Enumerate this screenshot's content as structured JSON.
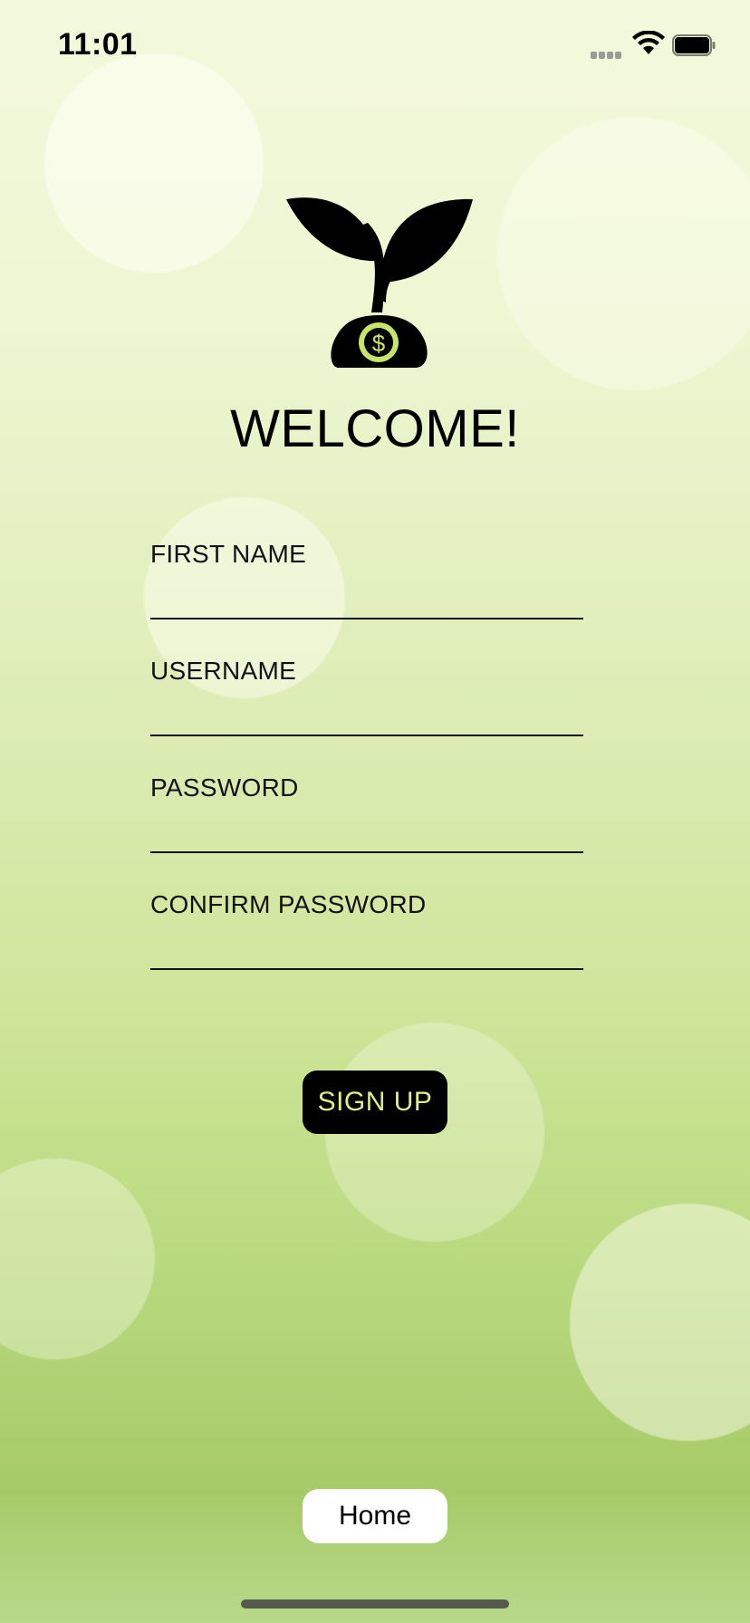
{
  "status_bar": {
    "time": "11:01",
    "icons": [
      "cellular-signal-icon",
      "wifi-icon",
      "battery-icon"
    ]
  },
  "header": {
    "logo_icon": "sprout-with-dollar-coin-icon",
    "title": "WELCOME!"
  },
  "form": {
    "fields": [
      {
        "label": "FIRST NAME",
        "value": ""
      },
      {
        "label": "USERNAME",
        "value": ""
      },
      {
        "label": "PASSWORD",
        "value": ""
      },
      {
        "label": "CONFIRM PASSWORD",
        "value": ""
      }
    ],
    "submit_label": "SIGN UP"
  },
  "footer": {
    "home_label": "Home"
  },
  "colors": {
    "accent": "#dcef8a",
    "button_bg": "#000000",
    "text": "#000000"
  }
}
